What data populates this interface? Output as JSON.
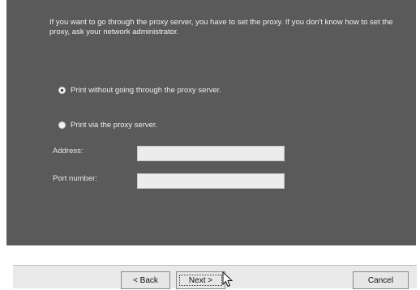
{
  "intro_text": "If you want to go through the proxy server, you have to set the proxy. If you don't know how to set the proxy, ask your network administrator.",
  "options": [
    {
      "label": "Print without going through the proxy server.",
      "checked": true
    },
    {
      "label": "Print via the proxy server.",
      "checked": false
    }
  ],
  "fields": {
    "address_label": "Address:",
    "address_value": "",
    "port_label": "Port number:",
    "port_value": ""
  },
  "buttons": {
    "back": "< Back",
    "next": "Next >",
    "cancel": "Cancel"
  },
  "icons": {
    "pointer": "mouse-pointer-icon"
  },
  "colors": {
    "panel": "#5a5a5a",
    "panel_text": "#f2f2f2",
    "button_face": "#e6e6e6"
  }
}
